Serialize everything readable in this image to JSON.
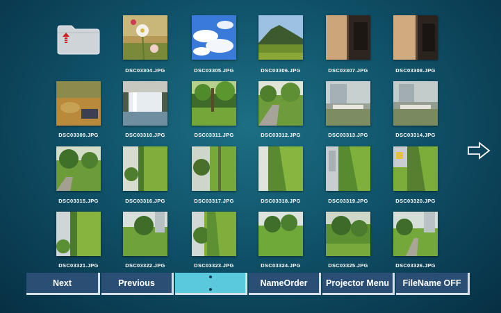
{
  "grid": {
    "files": [
      "DSC03304.JPG",
      "DSC03305.JPG",
      "DSC03306.JPG",
      "DSC03307.JPG",
      "DSC03308.JPG",
      "DSC03309.JPG",
      "DSC03310.JPG",
      "DSC03311.JPG",
      "DSC03312.JPG",
      "DSC03313.JPG",
      "DSC03314.JPG",
      "DSC03315.JPG",
      "DSC03316.JPG",
      "DSC03317.JPG",
      "DSC03318.JPG",
      "DSC03319.JPG",
      "DSC03320.JPG",
      "DSC03321.JPG",
      "DSC03322.JPG",
      "DSC03323.JPG",
      "DSC03324.JPG",
      "DSC03325.JPG",
      "DSC03326.JPG"
    ]
  },
  "toolbar": {
    "next": "Next",
    "previous": "Previous",
    "blank": "",
    "name_order": "NameOrder",
    "projector_menu": "Projector Menu",
    "filename_off": "FileName OFF"
  },
  "icons": {
    "up_folder": "folder-up-icon",
    "next_page": "arrow-right-icon"
  },
  "colors": {
    "button_bg": "#2a4e74",
    "button_active": "#5bc9dd",
    "text": "#ffffff"
  }
}
